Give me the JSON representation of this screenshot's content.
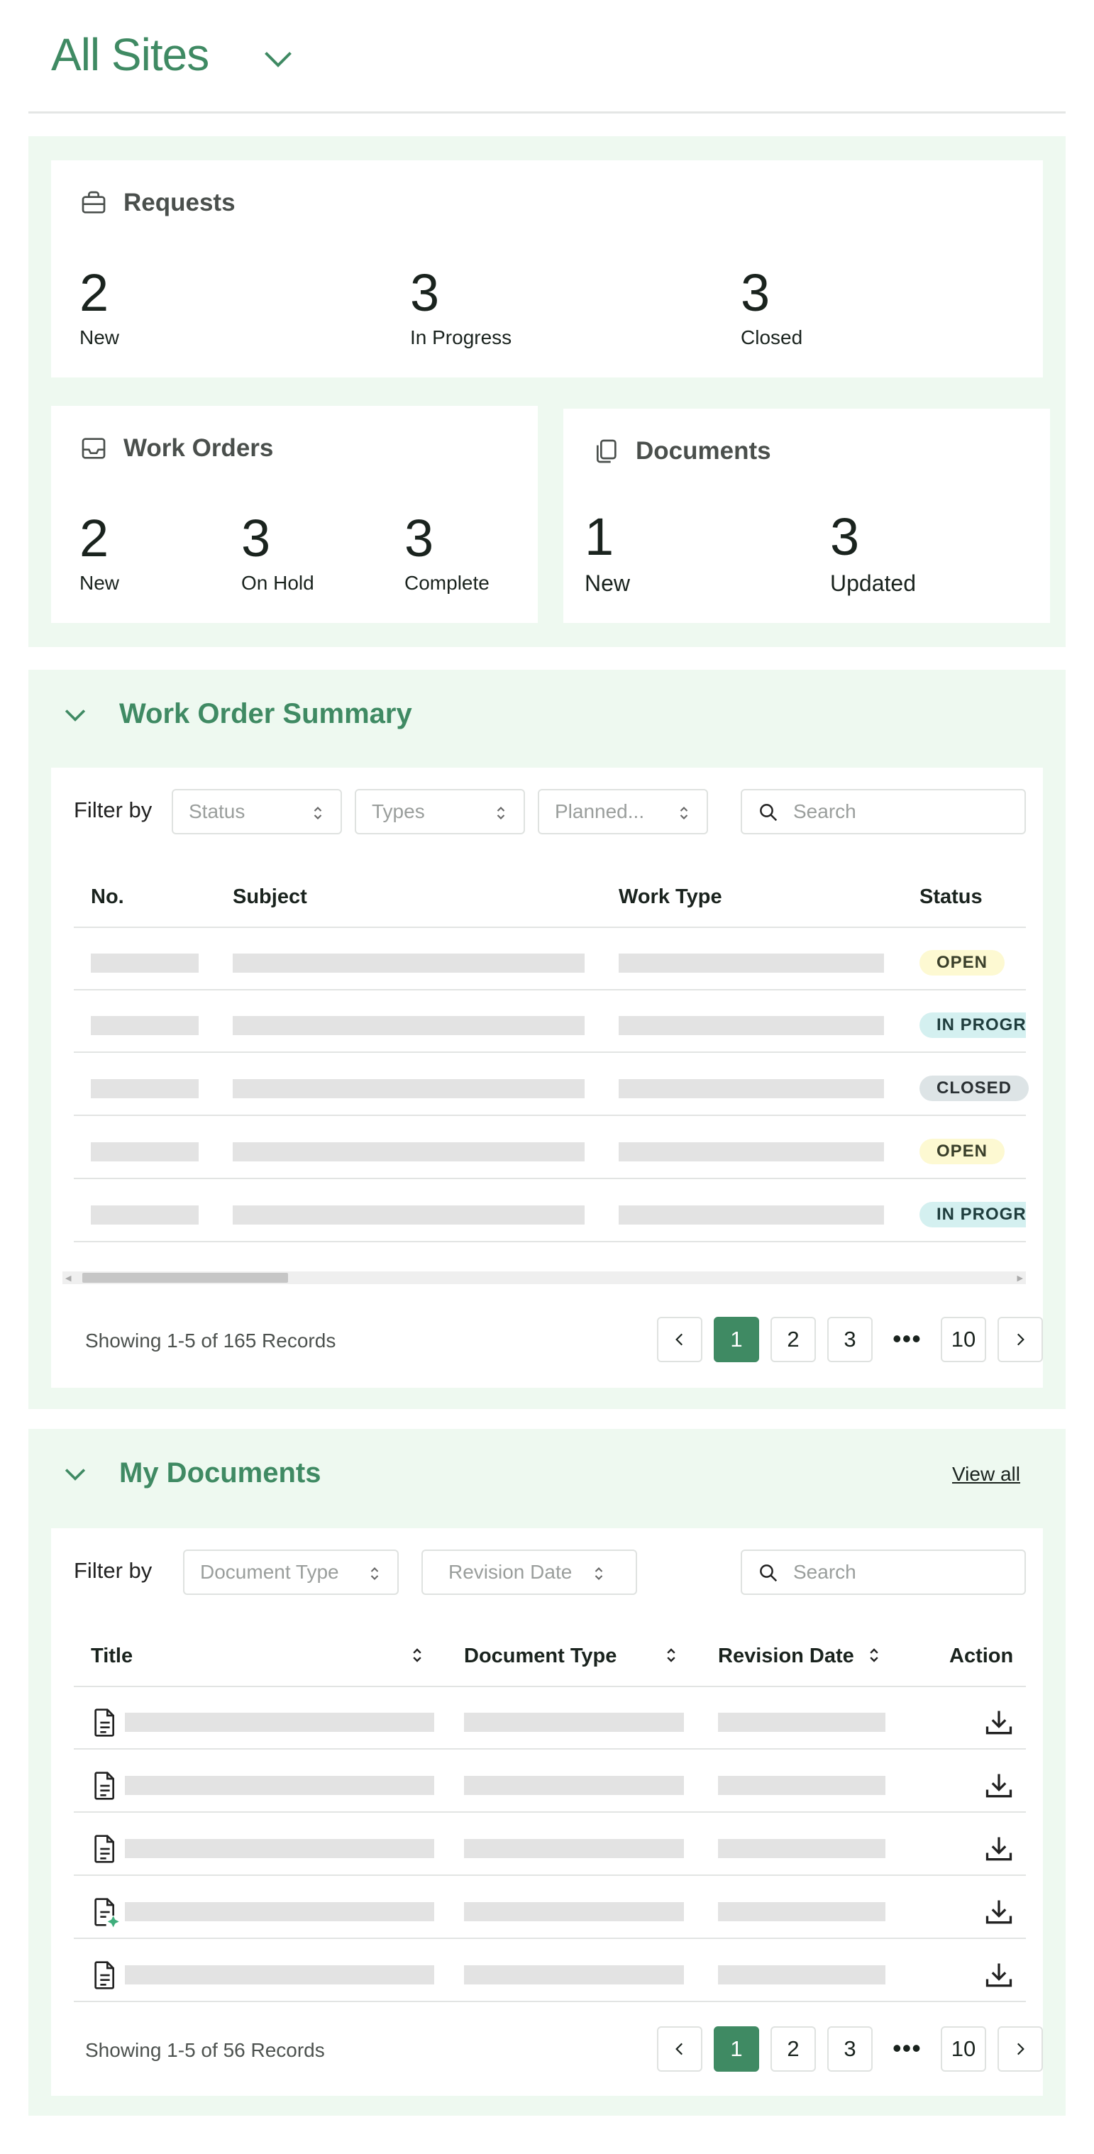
{
  "header": {
    "site_title": "All Sites"
  },
  "summary": {
    "requests": {
      "title": "Requests",
      "stats": [
        {
          "value": "2",
          "label": "New"
        },
        {
          "value": "3",
          "label": "In Progress"
        },
        {
          "value": "3",
          "label": "Closed"
        }
      ]
    },
    "work_orders": {
      "title": "Work Orders",
      "stats": [
        {
          "value": "2",
          "label": "New"
        },
        {
          "value": "3",
          "label": "On Hold"
        },
        {
          "value": "3",
          "label": "Complete"
        }
      ]
    },
    "documents": {
      "title": "Documents",
      "stats": [
        {
          "value": "1",
          "label": "New"
        },
        {
          "value": "3",
          "label": "Updated"
        }
      ]
    }
  },
  "work_order_summary": {
    "title": "Work Order Summary",
    "filter_label": "Filter by",
    "filters": [
      "Status",
      "Types",
      "Planned..."
    ],
    "search_placeholder": "Search",
    "columns": [
      "No.",
      "Subject",
      "Work Type",
      "Status"
    ],
    "rows": [
      {
        "status": "OPEN",
        "status_color": "#fdf9d2"
      },
      {
        "status": "IN PROGRESS",
        "status_color": "#d4f0f0"
      },
      {
        "status": "CLOSED",
        "status_color": "#dde4e6"
      },
      {
        "status": "OPEN",
        "status_color": "#fdf9d2"
      },
      {
        "status": "IN PROGRESS",
        "status_color": "#d4f0f0"
      }
    ],
    "records_text": "Showing 1-5 of 165 Records",
    "pagination": {
      "pages": [
        "1",
        "2",
        "3"
      ],
      "ellipsis": "•••",
      "last": "10",
      "current": "1"
    }
  },
  "my_documents": {
    "title": "My Documents",
    "view_all": "View all",
    "filter_label": "Filter by",
    "filters": [
      "Document Type",
      "Revision Date"
    ],
    "search_placeholder": "Search",
    "columns": [
      "Title",
      "Document Type",
      "Revision Date",
      "Action"
    ],
    "rows": [
      {
        "icon": "document-icon"
      },
      {
        "icon": "document-icon"
      },
      {
        "icon": "document-icon"
      },
      {
        "icon": "document-new-icon"
      },
      {
        "icon": "document-icon"
      }
    ],
    "records_text": "Showing 1-5 of 56 Records",
    "pagination": {
      "pages": [
        "1",
        "2",
        "3"
      ],
      "ellipsis": "•••",
      "last": "10",
      "current": "1"
    }
  },
  "colors": {
    "accent": "#3f8a63",
    "panel_bg": "#eef9f0",
    "skeleton": "#e3e3e3"
  }
}
